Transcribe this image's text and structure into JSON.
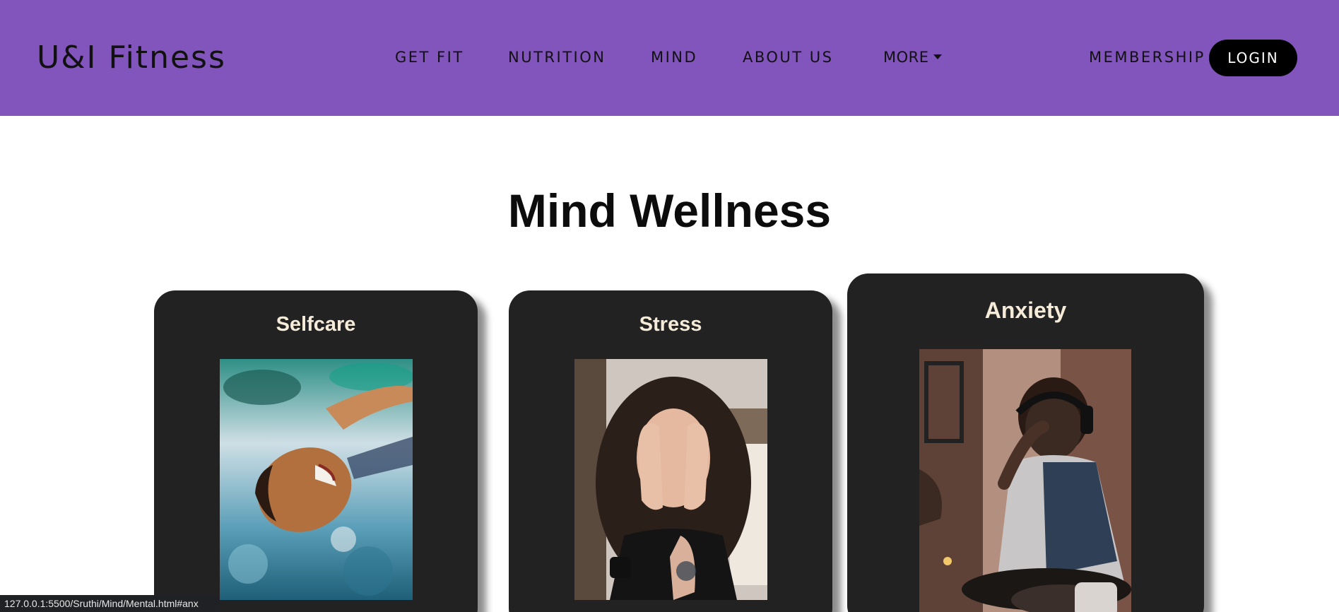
{
  "navbar": {
    "brand": "U&I Fitness",
    "links": [
      "GET FIT",
      "NUTRITION",
      "MIND",
      "ABOUT US"
    ],
    "more_label": "MORE",
    "membership_label": "MEMBERSHIP",
    "login_label": "LOGIN"
  },
  "main": {
    "title": "Mind Wellness",
    "cards": [
      {
        "title": "Selfcare",
        "image": "woman-floating-in-water-photo"
      },
      {
        "title": "Stress",
        "image": "woman-covering-face-photo"
      },
      {
        "title": "Anxiety",
        "image": "man-with-headphones-hand-on-forehead-photo"
      }
    ]
  },
  "statusbar": {
    "url": "127.0.0.1:5500/Sruthi/Mind/Mental.html#anx"
  },
  "colors": {
    "navbar": "#8155bb",
    "card": "#222222",
    "card_title": "#f5ebd8",
    "login_bg": "#000000"
  }
}
